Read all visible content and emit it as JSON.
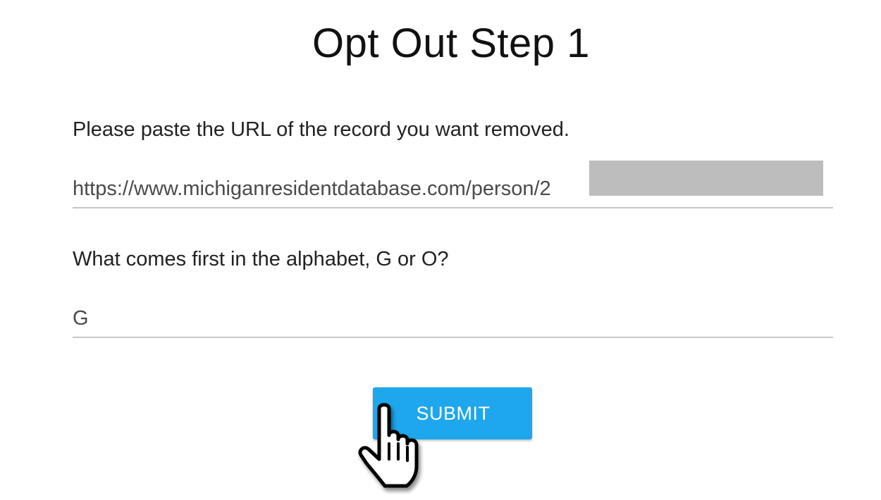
{
  "page": {
    "title": "Opt Out Step 1"
  },
  "form": {
    "url_field": {
      "label": "Please paste the URL of the record you want removed.",
      "value": "https://www.michiganresidentdatabase.com/person/2"
    },
    "captcha_field": {
      "label": "What comes first in the alphabet, G or O?",
      "value": "G"
    },
    "submit_label": "SUBMIT"
  },
  "colors": {
    "accent": "#1ea7ec",
    "input_underline": "#c7c7c7",
    "redaction": "#bdbdbd"
  },
  "icons": {
    "pointer": "hand-pointer-cursor-icon"
  }
}
